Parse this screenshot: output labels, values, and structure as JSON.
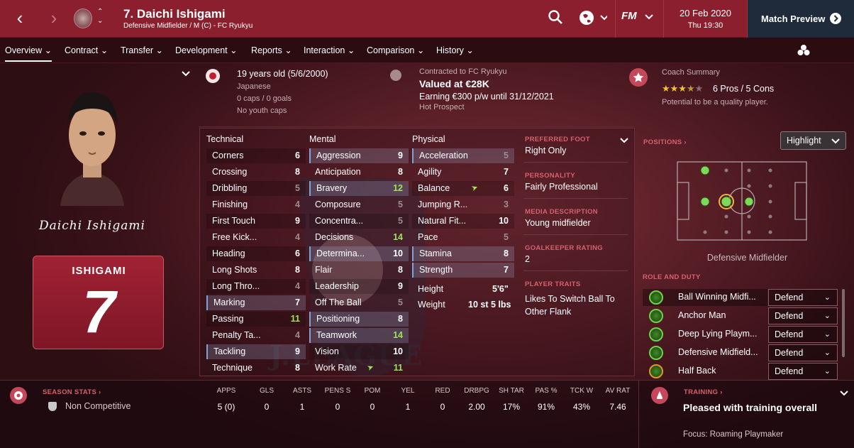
{
  "header": {
    "title": "7. Daichi Ishigami",
    "subtitle": "Defensive Midfielder / M (C) - FC Ryukyu",
    "date": "20 Feb 2020",
    "time": "Thu 19:30",
    "match_preview": "Match Preview",
    "fm": "FM"
  },
  "nav": [
    "Overview",
    "Contract",
    "Transfer",
    "Development",
    "Reports",
    "Interaction",
    "Comparison",
    "History"
  ],
  "bio": {
    "age": "19 years old (5/6/2000)",
    "nationality": "Japanese",
    "caps": "0 caps / 0 goals",
    "youth": "No youth caps"
  },
  "contract": {
    "line1": "Contracted to FC Ryukyu",
    "value": "Valued at €28K",
    "earning": "Earning €300 p/w until 31/12/2021",
    "prospect": "Hot Prospect"
  },
  "coach": {
    "title": "Coach Summary",
    "stars": 3.5,
    "pros": "6 Pros / 5 Cons",
    "summary": "Potential to be a quality player."
  },
  "signature": "Daichi Ishigami",
  "shirt": {
    "name": "ISHIGAMI",
    "number": "7"
  },
  "technical_header": "Technical",
  "mental_header": "Mental",
  "physical_header": "Physical",
  "technical": [
    {
      "n": "Corners",
      "v": "6"
    },
    {
      "n": "Crossing",
      "v": "8"
    },
    {
      "n": "Dribbling",
      "v": "5"
    },
    {
      "n": "Finishing",
      "v": "4"
    },
    {
      "n": "First Touch",
      "v": "9"
    },
    {
      "n": "Free Kick...",
      "v": "4"
    },
    {
      "n": "Heading",
      "v": "6"
    },
    {
      "n": "Long Shots",
      "v": "8"
    },
    {
      "n": "Long Thro...",
      "v": "4"
    },
    {
      "n": "Marking",
      "v": "7"
    },
    {
      "n": "Passing",
      "v": "11"
    },
    {
      "n": "Penalty Ta...",
      "v": "4"
    },
    {
      "n": "Tackling",
      "v": "9"
    },
    {
      "n": "Technique",
      "v": "8"
    }
  ],
  "mental": [
    {
      "n": "Aggression",
      "v": "9"
    },
    {
      "n": "Anticipation",
      "v": "8"
    },
    {
      "n": "Bravery",
      "v": "12"
    },
    {
      "n": "Composure",
      "v": "5"
    },
    {
      "n": "Concentra...",
      "v": "5"
    },
    {
      "n": "Decisions",
      "v": "14"
    },
    {
      "n": "Determina...",
      "v": "10"
    },
    {
      "n": "Flair",
      "v": "8"
    },
    {
      "n": "Leadership",
      "v": "9"
    },
    {
      "n": "Off The Ball",
      "v": "5"
    },
    {
      "n": "Positioning",
      "v": "8"
    },
    {
      "n": "Teamwork",
      "v": "14"
    },
    {
      "n": "Vision",
      "v": "10"
    },
    {
      "n": "Work Rate",
      "v": "11"
    }
  ],
  "physical": [
    {
      "n": "Acceleration",
      "v": "5"
    },
    {
      "n": "Agility",
      "v": "7"
    },
    {
      "n": "Balance",
      "v": "6"
    },
    {
      "n": "Jumping R...",
      "v": "3"
    },
    {
      "n": "Natural Fit...",
      "v": "10"
    },
    {
      "n": "Pace",
      "v": "5"
    },
    {
      "n": "Stamina",
      "v": "8"
    },
    {
      "n": "Strength",
      "v": "7"
    }
  ],
  "height": {
    "label": "Height",
    "value": "5'6\""
  },
  "weight": {
    "label": "Weight",
    "value": "10 st 5 lbs"
  },
  "info": {
    "foot_label": "PREFERRED FOOT",
    "foot": "Right Only",
    "personality_label": "PERSONALITY",
    "personality": "Fairly Professional",
    "media_label": "MEDIA DESCRIPTION",
    "media": "Young midfielder",
    "gk_label": "GOALKEEPER RATING",
    "gk": "2",
    "traits_label": "PLAYER TRAITS",
    "traits": "Likes To Switch Ball To Other Flank"
  },
  "positions": {
    "label": "POSITIONS",
    "highlight": "Highlight",
    "position": "Defensive Midfielder"
  },
  "roles_label": "ROLE AND DUTY",
  "roles": [
    {
      "name": "Ball Winning Midfi...",
      "duty": "Defend"
    },
    {
      "name": "Anchor Man",
      "duty": "Defend"
    },
    {
      "name": "Deep Lying Playm...",
      "duty": "Defend"
    },
    {
      "name": "Defensive Midfield...",
      "duty": "Defend"
    },
    {
      "name": "Half Back",
      "duty": "Defend"
    }
  ],
  "season": {
    "label": "SEASON STATS",
    "competition": "Non Competitive",
    "headers": [
      "APPS",
      "GLS",
      "ASTS",
      "PENS S",
      "POM",
      "YEL",
      "RED",
      "DRBPG",
      "SH TAR",
      "PAS %",
      "TCK W",
      "AV RAT"
    ],
    "values": [
      "5 (0)",
      "0",
      "1",
      "0",
      "0",
      "1",
      "0",
      "2.00",
      "17%",
      "91%",
      "43%",
      "7.46"
    ]
  },
  "training": {
    "label": "TRAINING",
    "status": "Pleased with training overall",
    "focus": "Focus:  Roaming Playmaker"
  },
  "watermark": "J.LEAGUE",
  "colors": {
    "topbar": "#8c1f2e",
    "accent_green": "#9ee35a",
    "section_red": "#d6606e",
    "match_btn": "#1f2a3a"
  }
}
